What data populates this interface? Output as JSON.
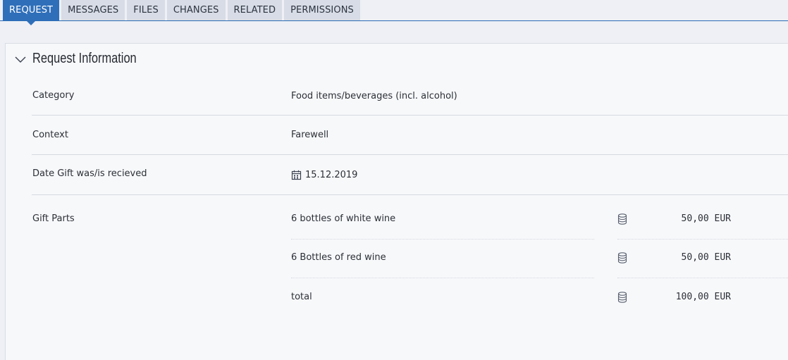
{
  "tabs": [
    {
      "label": "REQUEST",
      "active": true
    },
    {
      "label": "MESSAGES"
    },
    {
      "label": "FILES"
    },
    {
      "label": "CHANGES"
    },
    {
      "label": "RELATED"
    },
    {
      "label": "PERMISSIONS"
    }
  ],
  "section": {
    "title": "Request Information",
    "collapsed": false
  },
  "fields": {
    "category": {
      "label": "Category",
      "value": "Food items/beverages (incl. alcohol)"
    },
    "context": {
      "label": "Context",
      "value": "Farewell"
    },
    "date": {
      "label": "Date Gift was/is recieved",
      "value": "15.12.2019",
      "icon": "calendar-icon"
    },
    "gift_parts": {
      "label": "Gift Parts",
      "items": [
        {
          "description": "6 bottles of white wine",
          "amount": "50,00 EUR",
          "icon": "coins-icon"
        },
        {
          "description": "6 Bottles of red wine",
          "amount": "50,00 EUR",
          "icon": "coins-icon"
        }
      ],
      "total": {
        "label": "total",
        "amount": "100,00 EUR",
        "icon": "coins-icon"
      }
    }
  },
  "colors": {
    "accent": "#2f6fba",
    "tab_inactive": "#d7dce6",
    "background": "#eef0f5",
    "panel": "#f7f8fa",
    "divider": "#d5d9e0"
  }
}
